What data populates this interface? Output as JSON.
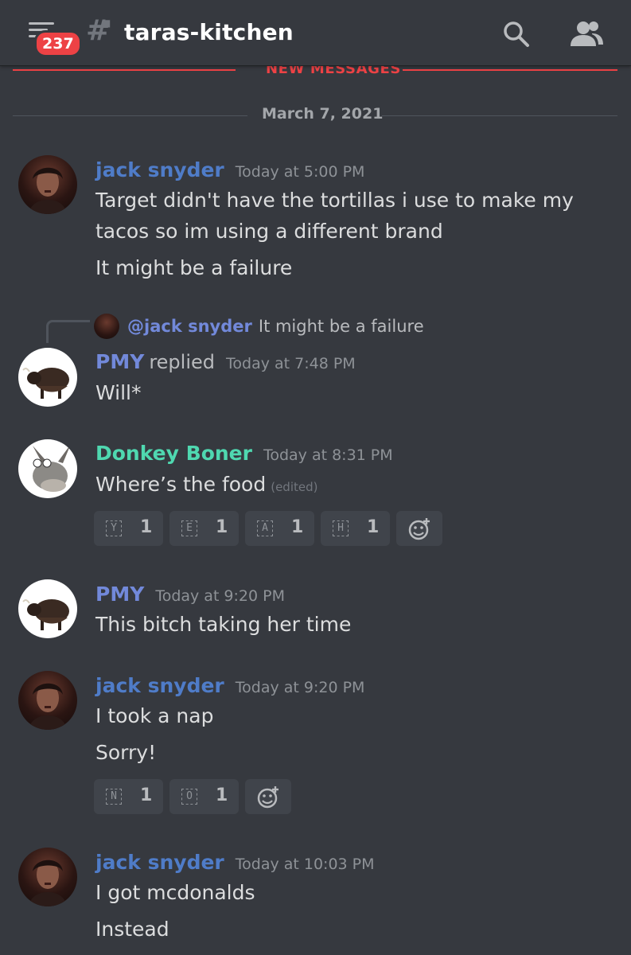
{
  "header": {
    "unread_badge": "237",
    "channel_name": "taras-kitchen",
    "icons": [
      "menu-icon",
      "hash-lock-icon",
      "search-icon",
      "members-icon"
    ]
  },
  "dividers": {
    "new_messages": "NEW MESSAGES",
    "date": "March 7, 2021"
  },
  "colors": {
    "background": "#36393f",
    "jack": "#4f7cc8",
    "pmy": "#7289da",
    "donkey": "#4fd8b0",
    "new_messages": "#ed4245"
  },
  "messages": [
    {
      "author": "jack snyder",
      "time": "Today at 5:00 PM",
      "lines": [
        "Target didn't have the tortillas i use to make my",
        "tacos so im using a different brand",
        "It might be a failure"
      ]
    },
    {
      "reply_to": {
        "mention": "@jack snyder",
        "text": "It might be a failure"
      },
      "author": "PMY",
      "replied": "replied",
      "time": "Today at 7:48 PM",
      "lines": [
        "Will*"
      ]
    },
    {
      "author": "Donkey Boner",
      "time": "Today at 8:31 PM",
      "lines": [
        "Where’s the food"
      ],
      "edited": "(edited)",
      "reactions": [
        {
          "emoji": "Y",
          "count": "1"
        },
        {
          "emoji": "E",
          "count": "1"
        },
        {
          "emoji": "A",
          "count": "1"
        },
        {
          "emoji": "H",
          "count": "1"
        }
      ]
    },
    {
      "author": "PMY",
      "time": "Today at 9:20 PM",
      "lines": [
        "This bitch taking her time"
      ]
    },
    {
      "author": "jack snyder",
      "time": "Today at 9:20 PM",
      "lines": [
        "I took a nap",
        "Sorry!"
      ],
      "reactions": [
        {
          "emoji": "N",
          "count": "1"
        },
        {
          "emoji": "O",
          "count": "1"
        }
      ]
    },
    {
      "author": "jack snyder",
      "time": "Today at 10:03 PM",
      "lines": [
        "I got mcdonalds",
        "Instead"
      ]
    }
  ]
}
